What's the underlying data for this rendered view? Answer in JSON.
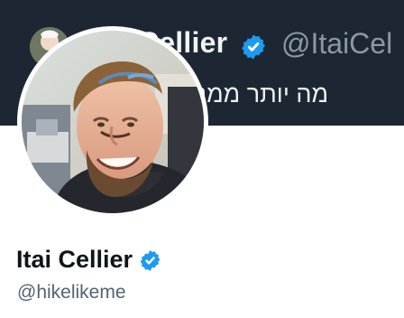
{
  "banner": {
    "name": "Cellier",
    "handle": "@ItaiCel",
    "text": "מה יותר ממני."
  },
  "profile": {
    "name": "Itai Cellier",
    "handle": "@hikelikeme"
  },
  "colors": {
    "verified": "#1d9bf0",
    "banner_background": "#1d2734",
    "name": "#0f1419",
    "handle": "#536471"
  }
}
